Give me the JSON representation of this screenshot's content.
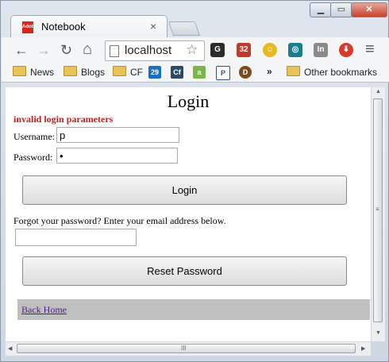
{
  "tab": {
    "title": "Notebook",
    "favicon_text": "Adobe",
    "close_glyph": "×"
  },
  "window": {
    "minimize_glyph": "▁",
    "maximize_glyph": "▭",
    "close_glyph": "✕"
  },
  "toolbar": {
    "back_glyph": "←",
    "forward_glyph": "→",
    "reload_glyph": "↻",
    "home_glyph": "⌂",
    "address": "localhost",
    "star_glyph": "☆",
    "menu_glyph": "≡",
    "extensions": [
      {
        "name": "g-extension-icon",
        "label": "G",
        "color": "#2b2b2b"
      },
      {
        "name": "db-extension-icon",
        "label": "32",
        "color": "#c0392b"
      },
      {
        "name": "smiley-extension-icon",
        "label": "☺",
        "color": "#e8b923"
      },
      {
        "name": "wave-extension-icon",
        "label": "◎",
        "color": "#1a7d8c"
      },
      {
        "name": "in-extension-icon",
        "label": "In",
        "color": "#8a8a8a"
      },
      {
        "name": "download-extension-icon",
        "label": "⬇",
        "color": "#d93b2b"
      }
    ]
  },
  "bookmarks": {
    "items": [
      "News",
      "Blogs",
      "CF"
    ],
    "icons": [
      {
        "name": "bookmark-29-icon",
        "label": "29",
        "color": "#1b6fc2"
      },
      {
        "name": "bookmark-cf-icon",
        "label": "Cf",
        "color": "#2c4a64"
      },
      {
        "name": "bookmark-android-icon",
        "label": "a",
        "color": "#7ab648"
      },
      {
        "name": "bookmark-p-icon",
        "label": "P",
        "color": "#2f4f8f"
      },
      {
        "name": "bookmark-d-icon",
        "label": "D",
        "color": "#7a4a1c"
      }
    ],
    "overflow_glyph": "»",
    "other": "Other bookmarks"
  },
  "page": {
    "title": "Login",
    "error": "invalid login parameters",
    "username_label": "Username:",
    "username_value": "p",
    "password_label": "Password:",
    "password_value": "•",
    "login_button": "Login",
    "forgot_text": "Forgot your password? Enter your email address below.",
    "email_value": "",
    "reset_button": "Reset Password",
    "back_link": "Back Home"
  },
  "scrollbars": {
    "up": "▲",
    "down": "▼",
    "left": "◀",
    "right": "▶",
    "grip_v": "≡",
    "grip_h": "III"
  }
}
